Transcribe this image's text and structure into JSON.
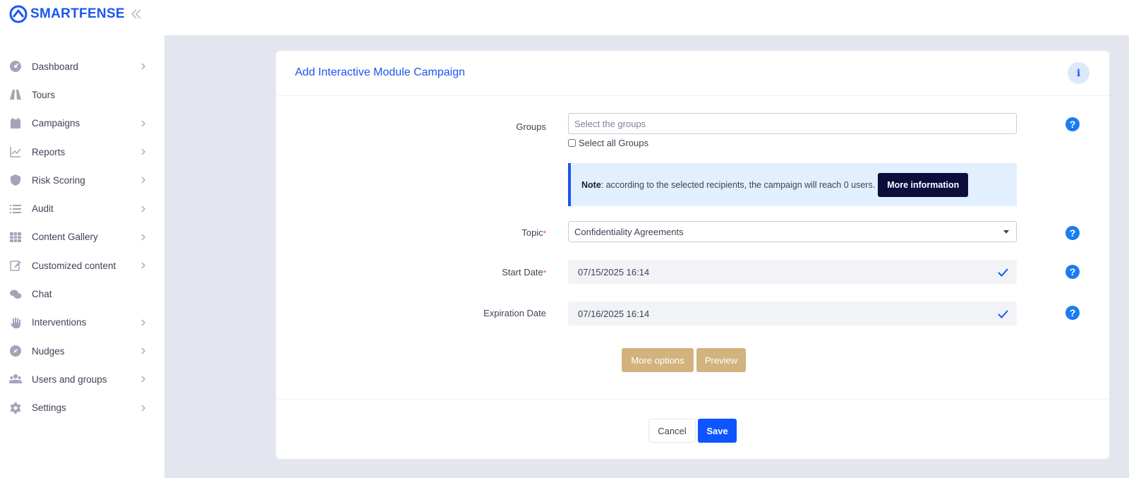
{
  "app": {
    "logo_text": "SMARTFENSE",
    "accent_color": "#1b56f2"
  },
  "sidebar": {
    "items": [
      {
        "label": "Dashboard",
        "icon": "dashboard-gauge-icon",
        "has_submenu": true
      },
      {
        "label": "Tours",
        "icon": "road-icon",
        "has_submenu": false
      },
      {
        "label": "Campaigns",
        "icon": "calendar-icon",
        "has_submenu": true
      },
      {
        "label": "Reports",
        "icon": "line-chart-icon",
        "has_submenu": true
      },
      {
        "label": "Risk Scoring",
        "icon": "shield-icon",
        "has_submenu": true
      },
      {
        "label": "Audit",
        "icon": "list-icon",
        "has_submenu": true
      },
      {
        "label": "Content Gallery",
        "icon": "grid-table-icon",
        "has_submenu": true
      },
      {
        "label": "Customized content",
        "icon": "edit-icon",
        "has_submenu": true
      },
      {
        "label": "Chat",
        "icon": "chat-icon",
        "has_submenu": false
      },
      {
        "label": "Interventions",
        "icon": "hand-icon",
        "has_submenu": true
      },
      {
        "label": "Nudges",
        "icon": "compass-icon",
        "has_submenu": true
      },
      {
        "label": "Users and groups",
        "icon": "users-icon",
        "has_submenu": true
      },
      {
        "label": "Settings",
        "icon": "gear-icon",
        "has_submenu": true
      }
    ]
  },
  "card": {
    "title": "Add Interactive Module Campaign",
    "info_label": "i"
  },
  "form": {
    "groups": {
      "label": "Groups",
      "placeholder": "Select the groups",
      "select_all_label": "Select all Groups",
      "select_all_checked": false
    },
    "note": {
      "bold": "Note",
      "text": ": according to the selected recipients, the campaign will reach 0 users.",
      "button": "More information"
    },
    "topic": {
      "label": "Topic",
      "required_mark": "*",
      "value": "Confidentiality Agreements"
    },
    "start_date": {
      "label": "Start Date",
      "required_mark": "*",
      "value": "07/15/2025 16:14"
    },
    "expiration_date": {
      "label": "Expiration Date",
      "value": "07/16/2025 16:14"
    },
    "help_label": "?",
    "more_options": "More options",
    "preview": "Preview"
  },
  "footer": {
    "cancel": "Cancel",
    "save": "Save"
  }
}
